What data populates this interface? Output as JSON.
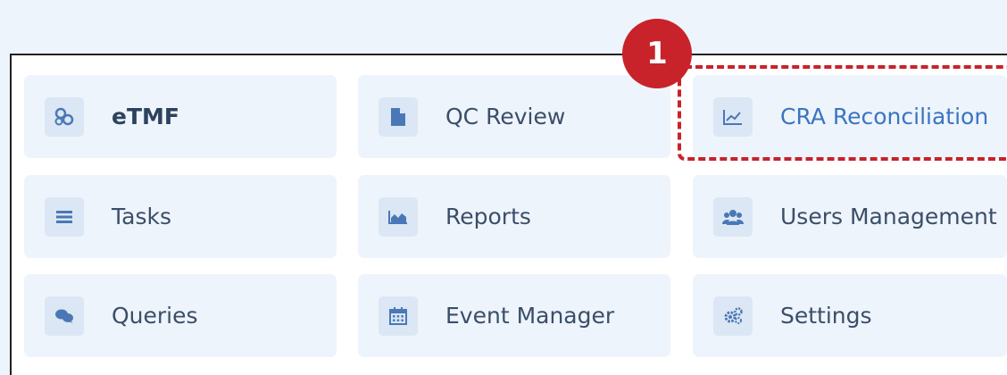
{
  "colors": {
    "accent": "#c8222a",
    "tile_bg": "#eef4fb",
    "icon_bg": "#dbe7f4",
    "icon": "#4a78b6"
  },
  "callout": {
    "number": "1"
  },
  "menu": {
    "items": [
      {
        "label": "eTMF",
        "icon": "cogs-cluster-icon"
      },
      {
        "label": "QC Review",
        "icon": "document-icon"
      },
      {
        "label": "CRA Reconciliation",
        "icon": "line-chart-icon"
      },
      {
        "label": "Tasks",
        "icon": "list-icon"
      },
      {
        "label": "Reports",
        "icon": "area-chart-icon"
      },
      {
        "label": "Users Management",
        "icon": "users-icon"
      },
      {
        "label": "Queries",
        "icon": "chat-bubbles-icon"
      },
      {
        "label": "Event Manager",
        "icon": "calendar-icon"
      },
      {
        "label": "Settings",
        "icon": "gears-icon"
      }
    ]
  }
}
